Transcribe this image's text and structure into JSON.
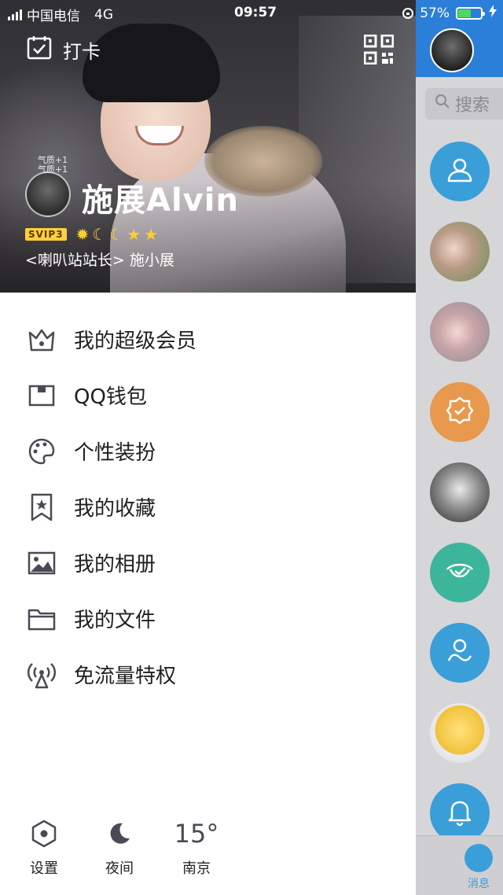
{
  "status_bar": {
    "carrier": "中国电信",
    "network": "4G",
    "time": "09:57",
    "battery": "57%",
    "battery_level": 0.57
  },
  "header": {
    "checkin_label": "打卡",
    "avatar_badge": "气质+1\n气质+1",
    "nickname": "施展Alvin",
    "vip_badge": "SVIP3",
    "signature": "<喇叭站站长> 施小展"
  },
  "menu": [
    {
      "icon": "crown-icon",
      "label": "我的超级会员"
    },
    {
      "icon": "wallet-icon",
      "label": "QQ钱包"
    },
    {
      "icon": "palette-icon",
      "label": "个性装扮"
    },
    {
      "icon": "bookmark-star-icon",
      "label": "我的收藏"
    },
    {
      "icon": "photo-icon",
      "label": "我的相册"
    },
    {
      "icon": "folder-icon",
      "label": "我的文件"
    },
    {
      "icon": "antenna-icon",
      "label": "免流量特权"
    }
  ],
  "bottom": {
    "settings_label": "设置",
    "night_label": "夜间",
    "temperature": "15°",
    "city": "南京"
  },
  "sliver": {
    "search_placeholder": "搜索",
    "tab_label": "消息"
  },
  "colors": {
    "accent": "#2b7fd8",
    "icon": "#4a4a55"
  }
}
